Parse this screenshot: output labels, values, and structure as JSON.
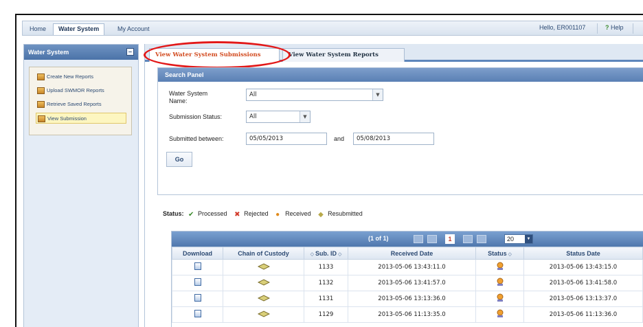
{
  "topnav": {
    "tabs": [
      "Home",
      "Water System",
      "My Account"
    ],
    "active_tab": "Water System",
    "greeting": "Hello, ER001107",
    "help": "Help"
  },
  "sidebar": {
    "title": "Water System",
    "items": [
      {
        "label": "Create New Reports"
      },
      {
        "label": "Upload SWMOR Reports"
      },
      {
        "label": "Retrieve Saved Reports"
      },
      {
        "label": "View Submission",
        "selected": true
      }
    ]
  },
  "tabs": {
    "submissions": "View Water System Submissions",
    "reports": "View Water System Reports"
  },
  "search": {
    "title": "Search Panel",
    "ws_name_label": "Water System Name:",
    "ws_name_value": "All",
    "status_label": "Submission Status:",
    "status_value": "All",
    "between_label": "Submitted between:",
    "from_date": "05/05/2013",
    "and_label": "and",
    "to_date": "05/08/2013",
    "go": "Go"
  },
  "legend": {
    "title": "Status:",
    "items": [
      "Processed",
      "Rejected",
      "Received",
      "Resubmitted"
    ]
  },
  "pager": {
    "label": "(1 of 1)",
    "current_page": "1",
    "page_size": "20"
  },
  "table": {
    "headers": [
      "Download",
      "Chain of Custody",
      "Sub. ID",
      "Received Date",
      "Status",
      "Status Date"
    ],
    "rows": [
      {
        "sub_id": "1133",
        "received": "2013-05-06 13:43:11.0",
        "status_date": "2013-05-06 13:43:15.0"
      },
      {
        "sub_id": "1132",
        "received": "2013-05-06 13:41:57.0",
        "status_date": "2013-05-06 13:41:58.0"
      },
      {
        "sub_id": "1131",
        "received": "2013-05-06 13:13:36.0",
        "status_date": "2013-05-06 13:13:37.0"
      },
      {
        "sub_id": "1129",
        "received": "2013-05-06 11:13:35.0",
        "status_date": "2013-05-06 11:13:36.0"
      }
    ]
  },
  "colors": {
    "highlight_oval": "#e21818",
    "active_tab_text": "#d24a1e",
    "header_blue": "#5a80b4"
  }
}
